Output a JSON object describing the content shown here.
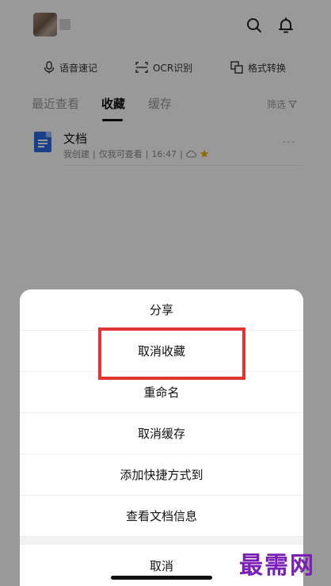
{
  "tools": [
    {
      "label": "语音速记",
      "icon": "microphone-icon"
    },
    {
      "label": "OCR识别",
      "icon": "scan-icon"
    },
    {
      "label": "格式转换",
      "icon": "convert-icon"
    }
  ],
  "tabs": [
    {
      "label": "最近查看",
      "active": false
    },
    {
      "label": "收藏",
      "active": true
    },
    {
      "label": "缓存",
      "active": false
    }
  ],
  "filter_label": "筛选",
  "file": {
    "title": "文档",
    "creator": "我创建",
    "permission": "仅我可查看",
    "time": "16:47",
    "more": "···"
  },
  "sheet": {
    "items": [
      "分享",
      "取消收藏",
      "重命名",
      "取消缓存",
      "添加快捷方式到",
      "查看文档信息"
    ],
    "cancel": "取消"
  },
  "watermark": "最需网",
  "colors": {
    "highlight": "#e3342f",
    "accent": "#2e6be6",
    "star": "#f5b400",
    "watermark": "#7a1fb5"
  }
}
